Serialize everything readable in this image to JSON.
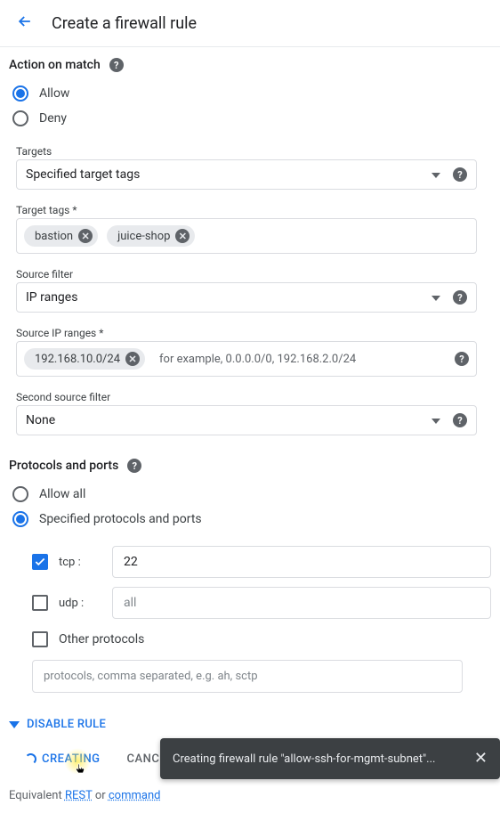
{
  "header": {
    "title": "Create a firewall rule"
  },
  "action_on_match": {
    "label": "Action on match",
    "options": {
      "allow": "Allow",
      "deny": "Deny"
    }
  },
  "targets": {
    "label": "Targets",
    "value": "Specified target tags"
  },
  "target_tags": {
    "label": "Target tags *",
    "chips": [
      "bastion",
      "juice-shop"
    ]
  },
  "source_filter": {
    "label": "Source filter",
    "value": "IP ranges"
  },
  "source_ip_ranges": {
    "label": "Source IP ranges *",
    "chips": [
      "192.168.10.0/24"
    ],
    "hint": "for example, 0.0.0.0/0, 192.168.2.0/24"
  },
  "second_source_filter": {
    "label": "Second source filter",
    "value": "None"
  },
  "protocols_ports": {
    "label": "Protocols and ports",
    "options": {
      "allow_all": "Allow all",
      "specified": "Specified protocols and ports"
    },
    "tcp": {
      "label": "tcp :",
      "value": "22"
    },
    "udp": {
      "label": "udp :",
      "placeholder": "all"
    },
    "other_label": "Other protocols",
    "other_placeholder": "protocols, comma separated, e.g. ah, sctp"
  },
  "disable_rule_label": "DISABLE RULE",
  "actions": {
    "creating": "CREATING",
    "cancel": "CANCEL"
  },
  "equivalent": {
    "prefix": "Equivalent ",
    "rest": "REST",
    "or": " or ",
    "cmd": "command"
  },
  "toast": {
    "message": "Creating firewall rule \"allow-ssh-for-mgmt-subnet\"..."
  }
}
